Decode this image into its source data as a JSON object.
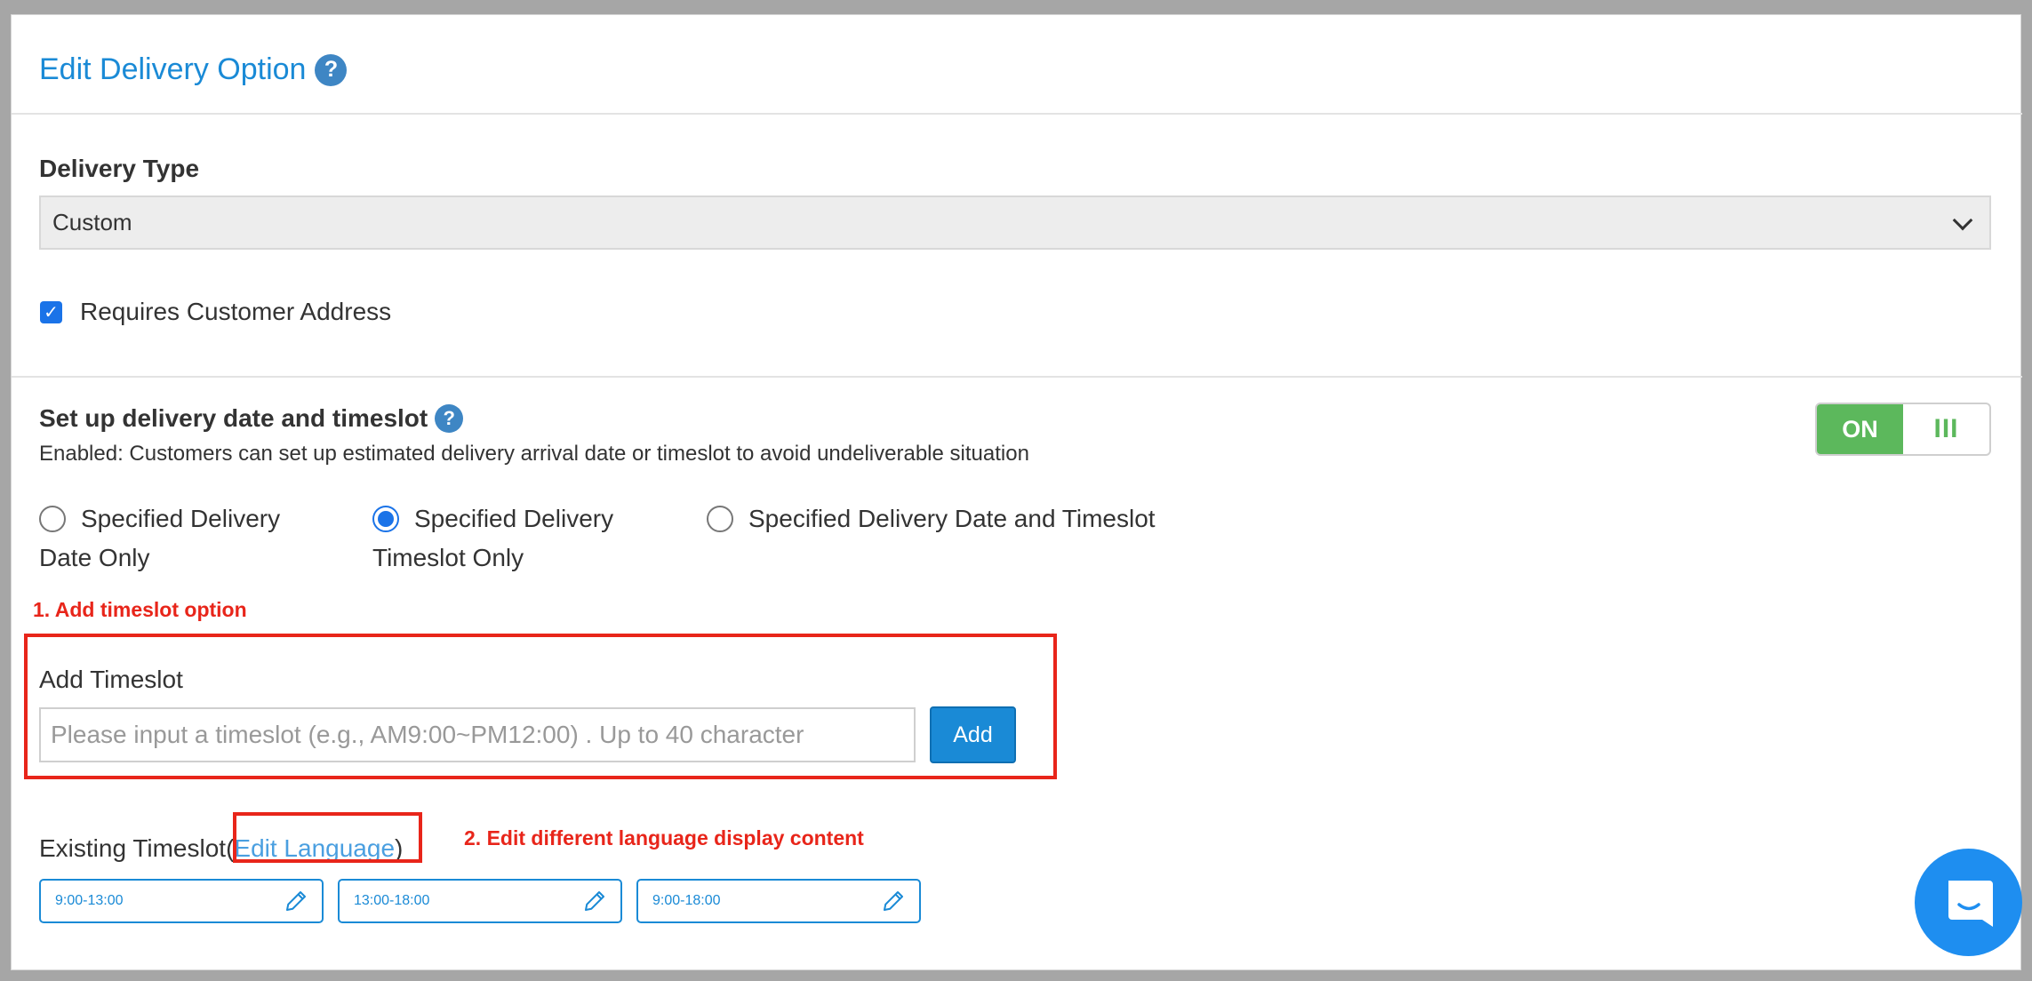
{
  "header": {
    "title": "Edit Delivery Option",
    "help_icon": "question-circle-icon"
  },
  "delivery_type": {
    "label": "Delivery Type",
    "selected": "Custom"
  },
  "requires_address": {
    "label": "Requires Customer Address",
    "checked": true
  },
  "timeslot_setup": {
    "title": "Set up delivery date and timeslot",
    "description": "Enabled: Customers can set up estimated delivery arrival date or timeslot to avoid undeliverable situation",
    "toggle_on_label": "ON",
    "toggle_handle": "III",
    "radios": [
      {
        "line1": "Specified Delivery",
        "line2": "Date Only",
        "checked": false
      },
      {
        "line1": "Specified Delivery",
        "line2": "Timeslot Only",
        "checked": true
      },
      {
        "line1": "Specified Delivery Date and Timeslot",
        "line2": "",
        "checked": false
      }
    ]
  },
  "annotations": {
    "step1": "1. Add timeslot option",
    "step2": "2. Edit different language display content"
  },
  "add_timeslot": {
    "label": "Add Timeslot",
    "placeholder": "Please input a timeslot (e.g., AM9:00~PM12:00) . Up to 40 character",
    "button": "Add"
  },
  "existing_timeslot": {
    "label": "Existing Timeslot",
    "open_paren": "(",
    "link": "Edit Language",
    "close_paren": ")",
    "chips": [
      "9:00-13:00",
      "13:00-18:00",
      "9:00-18:00"
    ]
  },
  "colors": {
    "accent": "#1a8ad6",
    "toggle_on": "#5cb85c",
    "annotation": "#e8251a"
  }
}
